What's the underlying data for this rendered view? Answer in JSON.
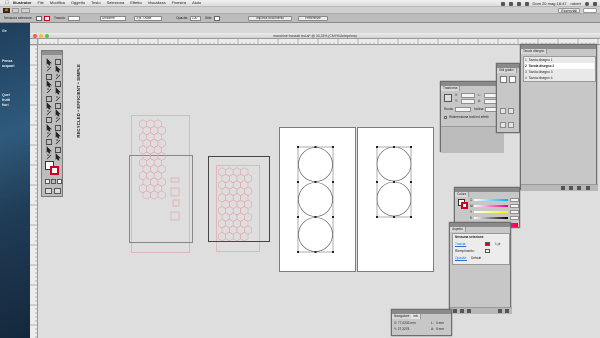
{
  "menubar": {
    "items": [
      "Illustrator",
      "File",
      "Modifica",
      "Oggetto",
      "Testo",
      "Seleziona",
      "Effetto",
      "Visualizza",
      "Finestra",
      "Aiuto"
    ],
    "clock": "Dom 20 mag  18:47",
    "user": "robert"
  },
  "appbar": {
    "workspace": "Essenziali"
  },
  "control": {
    "selection_label": "Nessuna selezione",
    "stroke_label": "Traccia",
    "stroke_style": "Uniforme",
    "brush": "3 pt. Ovale",
    "opacity_label": "Opacità",
    "opacity_value": "100",
    "style_label": "Stile",
    "doc_setup_btn": "Imposta documento",
    "prefs_btn": "Preferenze"
  },
  "bg_text": {
    "lines": [
      "Ge",
      "Pensa",
      "acquari",
      "Quel",
      "frutti",
      "fiori"
    ]
  },
  "document": {
    "title": "macchine fronzati red.ai* @ 33,33% (CMYK/Anteprima)"
  },
  "artwork": {
    "vertical_text": "RECYCLED • EFFICIENT • SIMPLE"
  },
  "panels": {
    "trasforma": {
      "tab": "Trasforma",
      "rows": [
        "X:",
        "Y:",
        "L:",
        "A:",
        "Ruota:",
        "Inclina:"
      ],
      "checkbox": "Ridimensiona tratti ed effetti"
    },
    "stroke_mini": {
      "tab": "Stili grafici"
    },
    "tavole": {
      "tab": "Tavole disegno",
      "items": [
        {
          "num": "1",
          "name": "Tavola disegno 1"
        },
        {
          "num": "2",
          "name": "Tavola disegno 2"
        },
        {
          "num": "3",
          "name": "Tavola disegno 3"
        },
        {
          "num": "4",
          "name": "Tavola disegno 4"
        }
      ]
    },
    "colore": {
      "tab": "Colore",
      "channels": [
        "C",
        "M",
        "Y",
        "K"
      ]
    },
    "aspetto": {
      "tab": "Aspetto",
      "heading": "Nessuna selezione",
      "rows": [
        {
          "label": "Traccia:",
          "value": "1 pt"
        },
        {
          "label": "Riempimento:",
          "value": ""
        },
        {
          "label": "Opacità:",
          "value": "Default"
        }
      ]
    },
    "info": {
      "tabs": [
        "Navigatore",
        "Info"
      ],
      "rows": [
        {
          "k": "X:",
          "v": "77,0233 mm",
          "k2": "L:",
          "v2": "0 mm"
        },
        {
          "k": "Y:",
          "v": "27,3278",
          "k2": "A:",
          "v2": "0 mm"
        }
      ]
    }
  },
  "colors": {
    "accent": "#2b6fd6",
    "stroke_red": "#d0021b",
    "panel_bg": "#c7c7c7"
  }
}
